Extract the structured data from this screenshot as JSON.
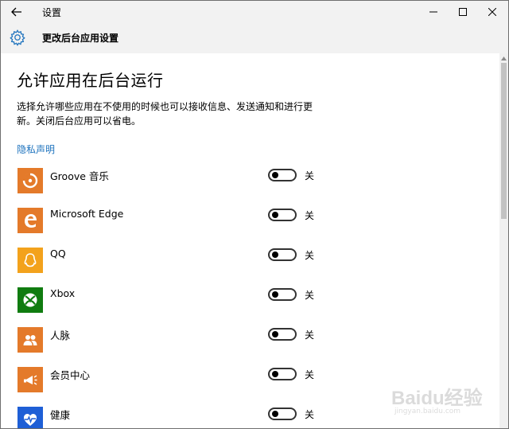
{
  "window": {
    "title": "设置"
  },
  "header": {
    "title": "更改后台应用设置"
  },
  "main": {
    "heading": "允许应用在后台运行",
    "description": "选择允许哪些应用在不使用的时候也可以接收信息、发送通知和进行更新。关闭后台应用可以省电。",
    "privacy_link": "隐私声明",
    "apps": [
      {
        "name": "Groove 音乐",
        "state": "关",
        "icon": "groove-music-icon",
        "color": "#e47a2a"
      },
      {
        "name": "Microsoft Edge",
        "state": "关",
        "icon": "edge-icon",
        "color": "#e47a2a"
      },
      {
        "name": "QQ",
        "state": "关",
        "icon": "qq-icon",
        "color": "#f3a21c"
      },
      {
        "name": "Xbox",
        "state": "关",
        "icon": "xbox-icon",
        "color": "#107c10"
      },
      {
        "name": "人脉",
        "state": "关",
        "icon": "people-icon",
        "color": "#e47a2a"
      },
      {
        "name": "会员中心",
        "state": "关",
        "icon": "member-center-icon",
        "color": "#e47a2a"
      },
      {
        "name": "健康",
        "state": "关",
        "icon": "health-icon",
        "color": "#1e5fd6"
      }
    ]
  },
  "watermark": {
    "text": "Baidu经验",
    "url": "jingyan.baidu.com"
  }
}
